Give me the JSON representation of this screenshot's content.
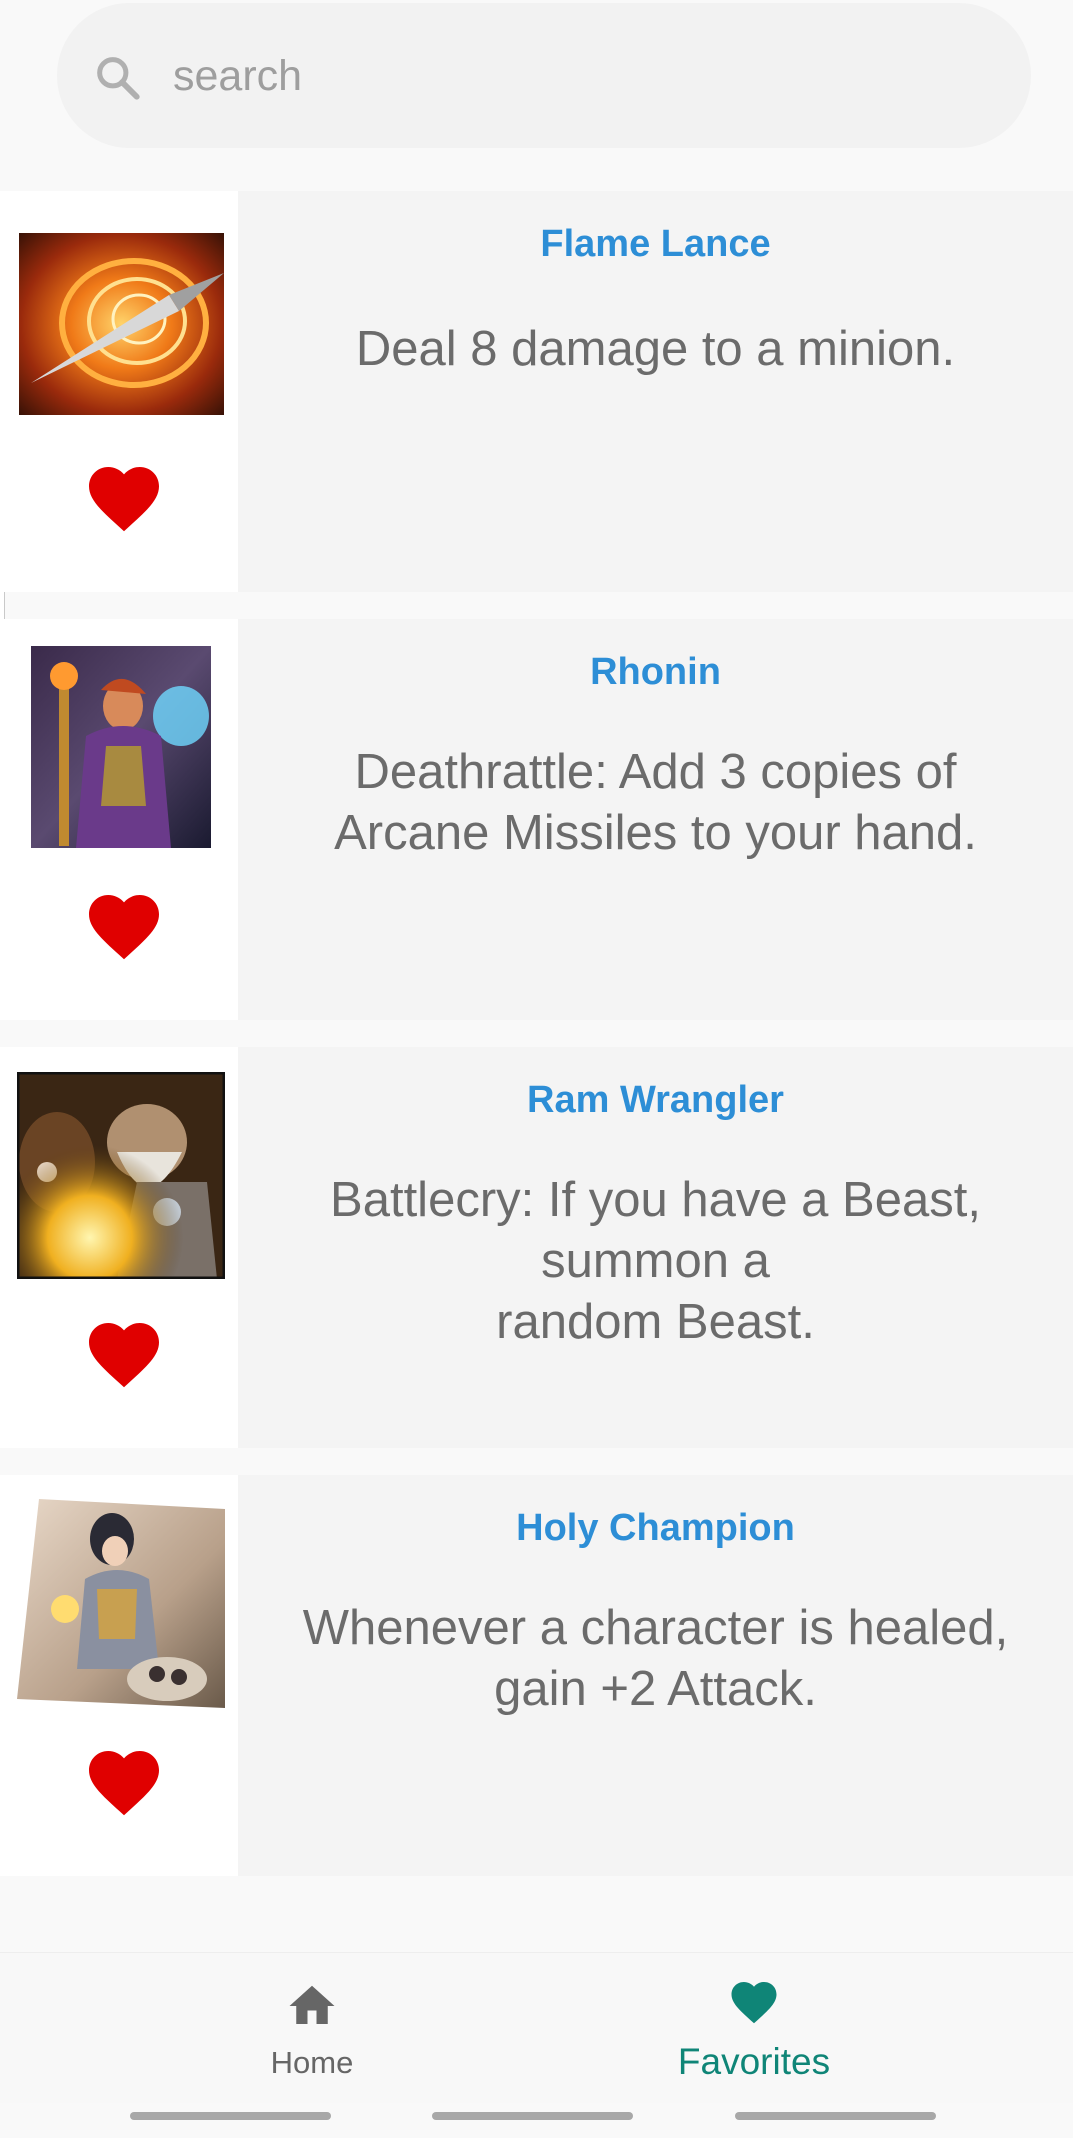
{
  "search": {
    "placeholder": "search",
    "value": ""
  },
  "cards": [
    {
      "name": "Flame Lance",
      "text": "Deal 8 damage to a minion.",
      "favorited": true,
      "art_icon": "flame-lance-art"
    },
    {
      "name": "Rhonin",
      "text": "Deathrattle:  Add 3 copies of\nArcane Missiles to your hand.",
      "favorited": true,
      "art_icon": "rhonin-art"
    },
    {
      "name": "Ram Wrangler",
      "text": "Battlecry:  If you have a Beast,\nsummon a\nrandom Beast.",
      "favorited": true,
      "art_icon": "ram-wrangler-art"
    },
    {
      "name": "Holy Champion",
      "text": "Whenever a character is healed,\ngain +2 Attack.",
      "favorited": true,
      "art_icon": "holy-champion-art"
    }
  ],
  "nav": {
    "home_label": "Home",
    "favorites_label": "Favorites",
    "active": "favorites"
  },
  "colors": {
    "title": "#2d8ed6",
    "heart": "#e00000",
    "active_tab": "#0f8577",
    "inactive_tab": "#666666"
  }
}
